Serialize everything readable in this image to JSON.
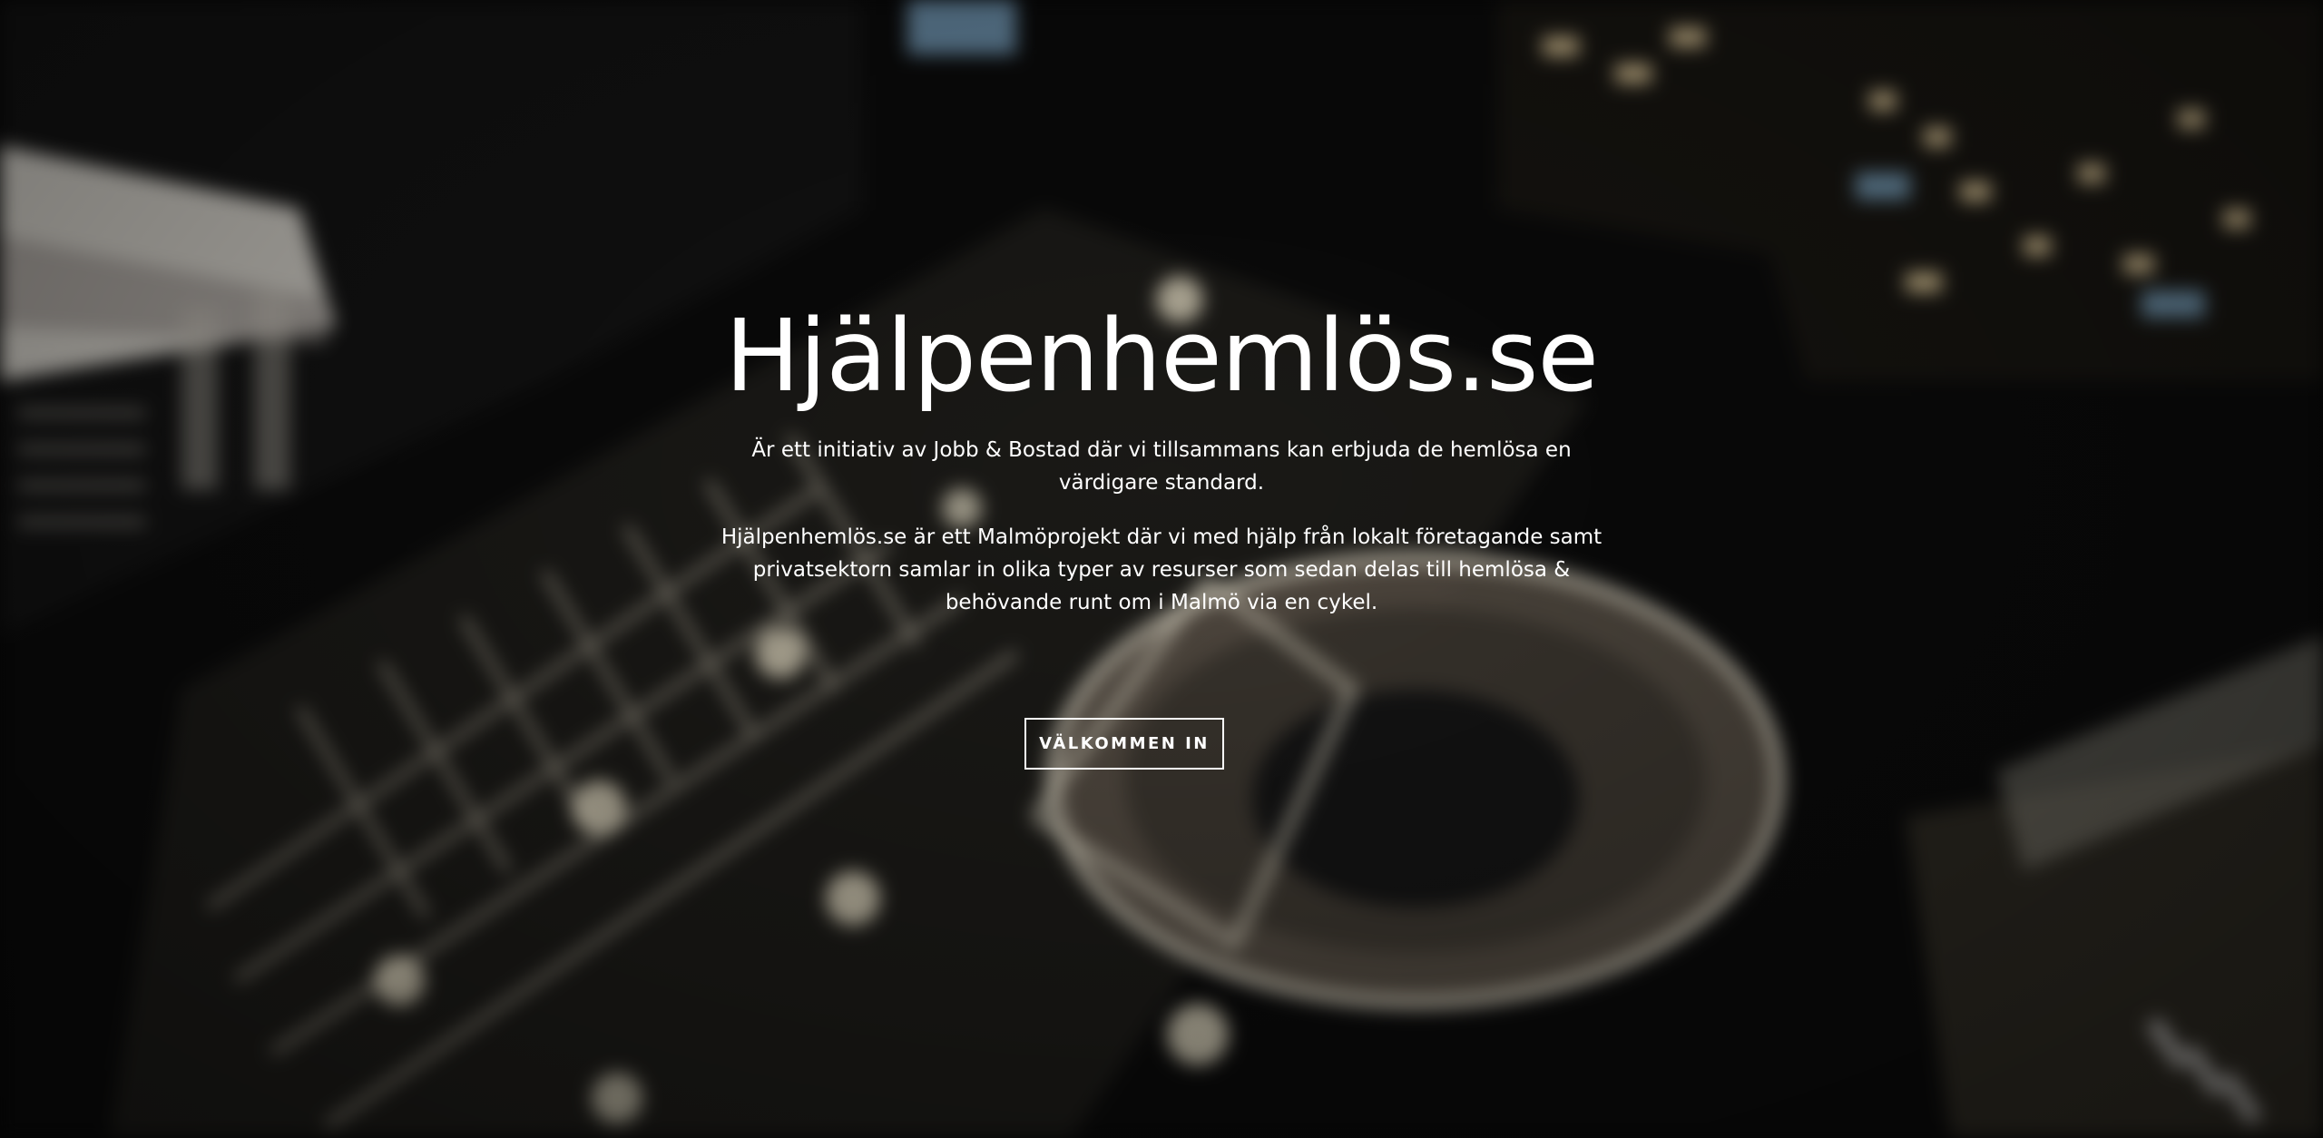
{
  "hero": {
    "title": "Hjälpenhemlös.se",
    "intro": "Är ett initiativ av Jobb & Bostad där vi tillsammans kan erbjuda de hemlösa en värdigare standard.",
    "description": "Hjälpenhemlös.se är ett Malmöprojekt där vi med hjälp från lokalt företagande samt privatsektorn samlar in olika typer av resurser som sedan delas till hemlösa & behövande runt om i Malmö via en cykel.",
    "cta_label": "VÄLKOMMEN IN"
  },
  "background": {
    "subject": "aerial-night-parking-garage-photo",
    "base_color": "#070707",
    "light_color": "#f2e6c8"
  }
}
